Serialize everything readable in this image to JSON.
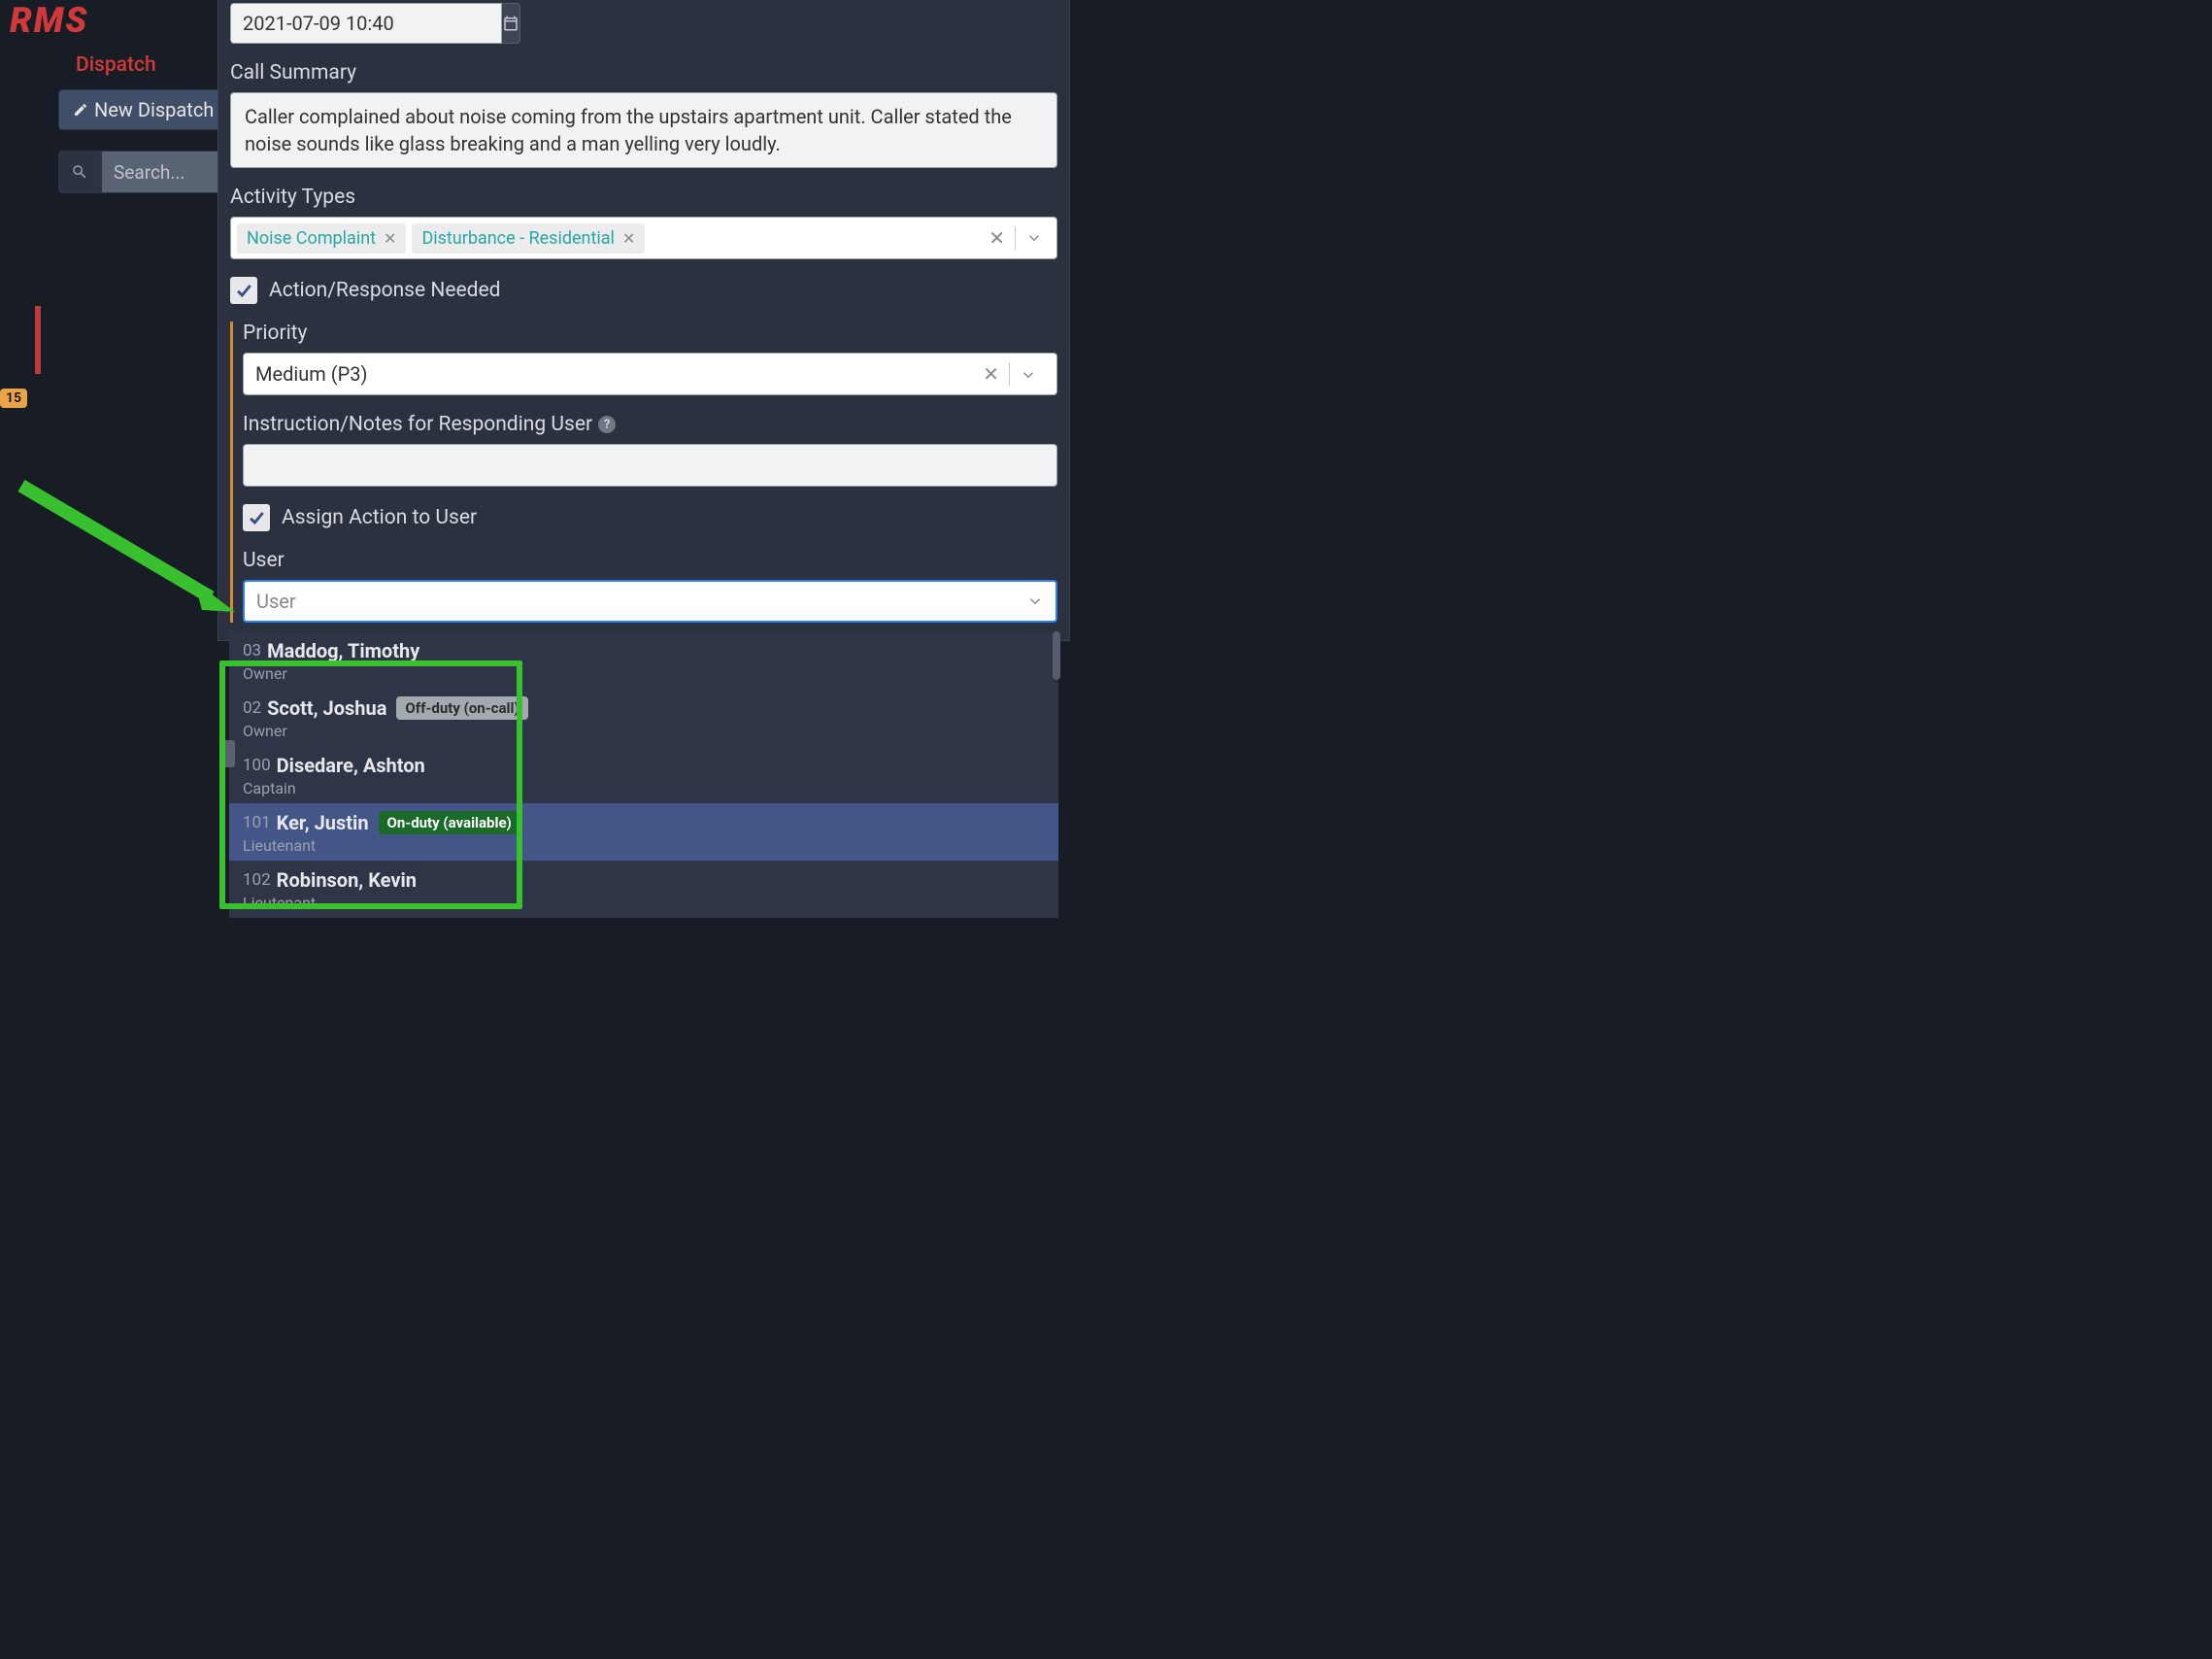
{
  "logo": "RMS",
  "sidebar": {
    "dispatch_label": "Dispatch",
    "new_dispatch": "New Dispatch",
    "search_placeholder": "Search...",
    "badge": "15"
  },
  "form": {
    "datetime": "2021-07-09 10:40",
    "summary_label": "Call Summary",
    "summary_text": "Caller complained about noise coming from the upstairs apartment unit. Caller stated the noise sounds like glass breaking and a man yelling very loudly.",
    "activity_label": "Activity Types",
    "activity_tags": [
      "Noise Complaint",
      "Disturbance - Residential"
    ],
    "action_needed": "Action/Response Needed",
    "priority_label": "Priority",
    "priority_value": "Medium (P3)",
    "notes_label": "Instruction/Notes for Responding User",
    "assign_label": "Assign Action to User",
    "user_label": "User",
    "user_placeholder": "User"
  },
  "users": [
    {
      "num": "03",
      "name": "Maddog, Timothy",
      "role": "Owner",
      "status": "",
      "status_class": ""
    },
    {
      "num": "02",
      "name": "Scott, Joshua",
      "role": "Owner",
      "status": "Off-duty (on-call)",
      "status_class": "pill-off"
    },
    {
      "num": "100",
      "name": "Disedare, Ashton",
      "role": "Captain",
      "status": "",
      "status_class": ""
    },
    {
      "num": "101",
      "name": "Ker, Justin",
      "role": "Lieutenant",
      "status": "On-duty (available)",
      "status_class": "pill-on"
    },
    {
      "num": "102",
      "name": "Robinson, Kevin",
      "role": "Lieutenant",
      "status": "",
      "status_class": ""
    }
  ]
}
